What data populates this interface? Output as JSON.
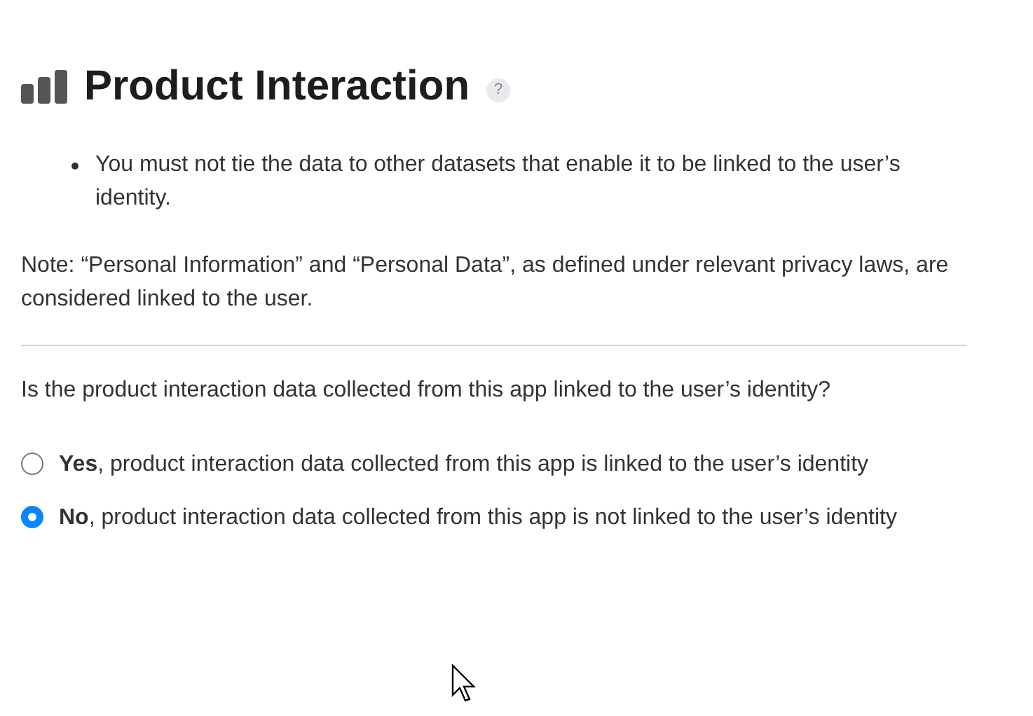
{
  "header": {
    "title": "Product Interaction",
    "help": "?"
  },
  "bullets": [
    "You must not tie the data to other datasets that enable it to be linked to the user’s identity."
  ],
  "note": "Note: “Personal Information” and “Personal Data”, as defined under relevant privacy laws, are considered linked to the user.",
  "question": "Is the product interaction data collected from this app linked to the user’s identity?",
  "options": [
    {
      "label": "**Yes**, product interaction data collected from this app is linked to the user’s identity",
      "selected": false
    },
    {
      "label": "**No**, product interaction data collected from this app is not linked to the user’s identity",
      "selected": true
    }
  ]
}
